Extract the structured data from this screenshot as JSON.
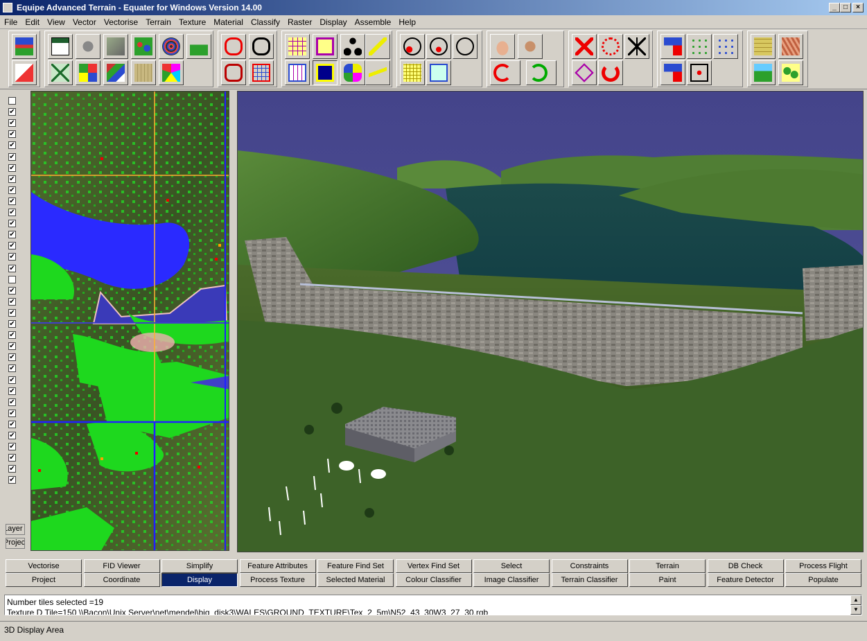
{
  "window": {
    "title": "Equipe Advanced Terrain - Equater for Windows Version 14.00",
    "controls": [
      "_",
      "□",
      "×"
    ]
  },
  "menu": [
    "File",
    "Edit",
    "View",
    "Vector",
    "Vectorise",
    "Terrain",
    "Texture",
    "Material",
    "Classify",
    "Raster",
    "Display",
    "Assemble",
    "Help"
  ],
  "layer_checkboxes": [
    false,
    true,
    true,
    true,
    true,
    true,
    true,
    true,
    true,
    true,
    true,
    true,
    true,
    true,
    true,
    true,
    false,
    true,
    true,
    true,
    true,
    true,
    true,
    true,
    true,
    true,
    true,
    true,
    true,
    true,
    true,
    true,
    true,
    true,
    true
  ],
  "left_tabs": [
    "Layer",
    "Project"
  ],
  "nav_buttons": {
    "row1": [
      "Vectorise",
      "FID Viewer",
      "Simplify",
      "Feature Attributes",
      "Feature Find Set",
      "Vertex Find Set",
      "Select",
      "Constraints",
      "Terrain",
      "DB Check",
      "Process Flight"
    ],
    "row2": [
      "Project",
      "Coordinate",
      "Display",
      "Process Texture",
      "Selected Material",
      "Colour Classifier",
      "Image Classifier",
      "Terrain Classifier",
      "Paint",
      "Feature Detector",
      "Populate"
    ],
    "active": "Display"
  },
  "log": [
    "Number tiles selected =19",
    "Texture D Tile=150 \\\\Bacon\\Unix Server\\net\\mendel\\big_disk3\\WALES\\GROUND_TEXTURE\\Tex_2_5m\\N52_43_30W3_27_30.rgb"
  ],
  "status": "3D Display Area"
}
